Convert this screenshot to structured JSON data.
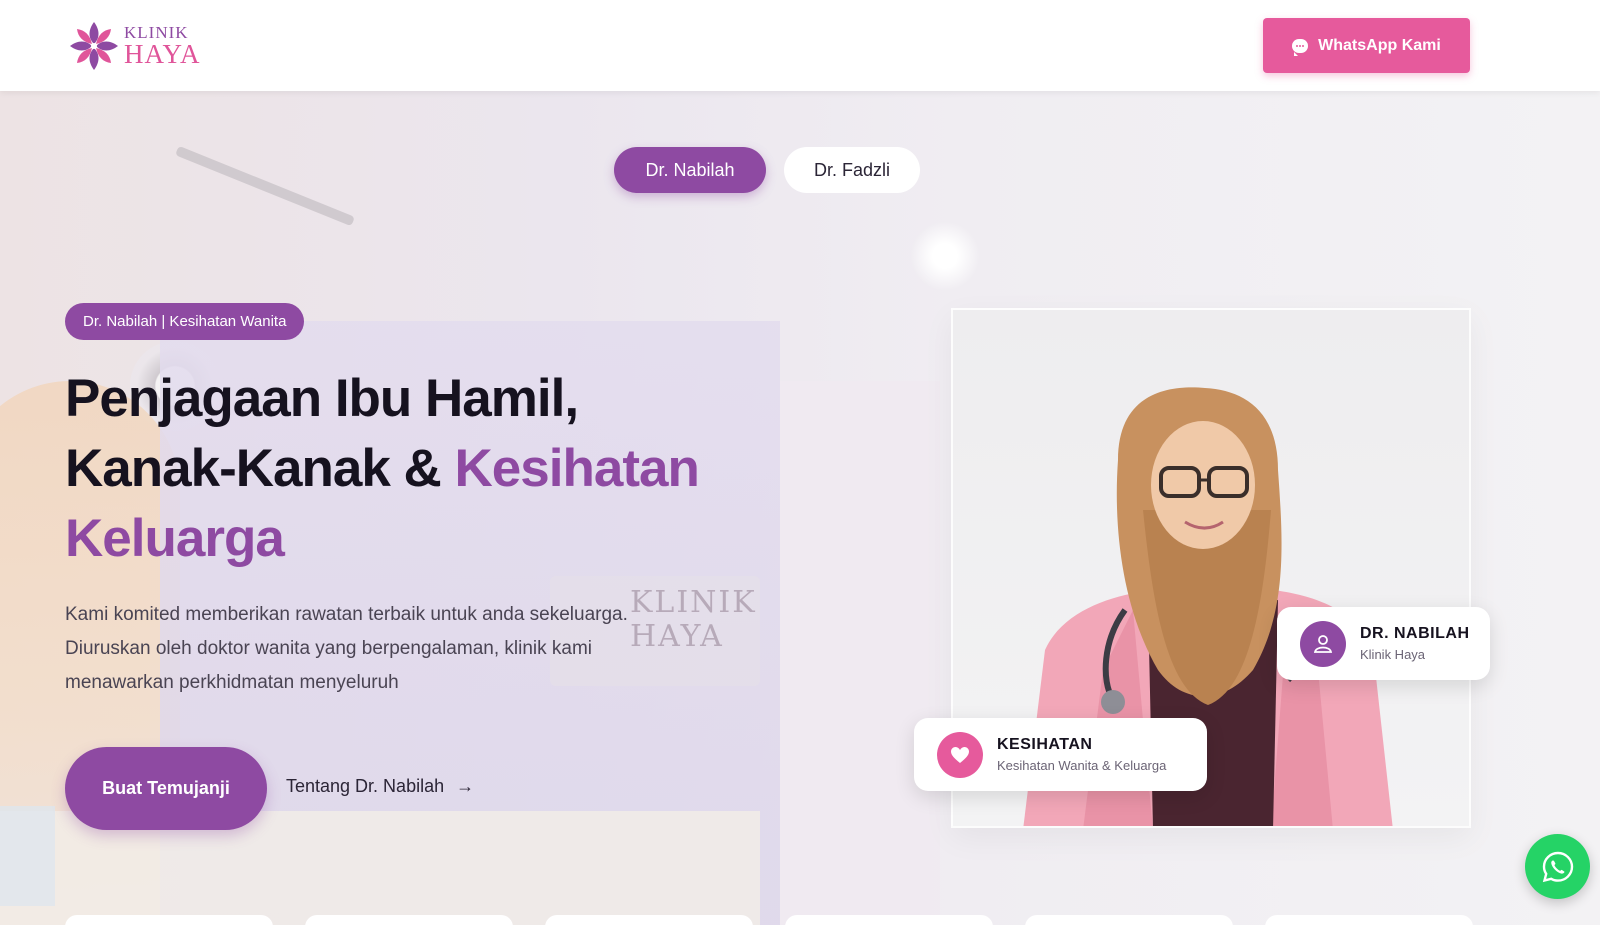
{
  "header": {
    "logo": {
      "line1": "KLINIK",
      "line2": "HAYA"
    },
    "whatsapp_button": "WhatsApp Kami"
  },
  "tabs": [
    {
      "label": "Dr. Nabilah",
      "active": true
    },
    {
      "label": "Dr. Fadzli",
      "active": false
    }
  ],
  "hero": {
    "badge": "Dr. Nabilah | Kesihatan Wanita",
    "headline_line1": "Penjagaan Ibu Hamil,",
    "headline_line2_prefix": "Kanak-Kanak & ",
    "headline_accent_1": "Kesihatan",
    "headline_accent_2": "Keluarga",
    "description": "Kami komited memberikan rawatan terbaik untuk anda sekeluarga. Diuruskan oleh doktor wanita yang berpengalaman, klinik kami menawarkan perkhidmatan menyeluruh",
    "cta_primary": "Buat Temujanji",
    "cta_link": "Tentang Dr. Nabilah",
    "cta_link_arrow": "→"
  },
  "doctor_card": {
    "name": "DR. NABILAH",
    "clinic": "Klinik Haya"
  },
  "specialty_card": {
    "title": "KESIHATAN",
    "subtitle": "Kesihatan Wanita & Keluarga"
  },
  "background_watermark": {
    "line1": "KLINIK",
    "line2": "HAYA"
  },
  "colors": {
    "brand_purple": "#8e4aa2",
    "brand_pink": "#e65a9c",
    "whatsapp_green": "#25d366"
  }
}
